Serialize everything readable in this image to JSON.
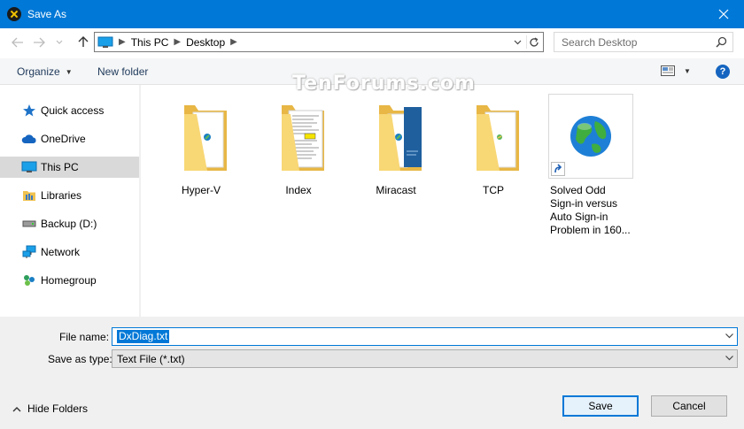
{
  "window": {
    "title": "Save As"
  },
  "address": {
    "crumbs": [
      "This PC",
      "Desktop"
    ]
  },
  "search": {
    "placeholder": "Search Desktop"
  },
  "toolbar": {
    "organize": "Organize",
    "new_folder": "New folder",
    "help": "?"
  },
  "nav": {
    "items": [
      {
        "label": "Quick access",
        "icon": "star-icon"
      },
      {
        "label": "OneDrive",
        "icon": "cloud-icon"
      },
      {
        "label": "This PC",
        "icon": "computer-icon",
        "selected": true
      },
      {
        "label": "Libraries",
        "icon": "library-folder-icon"
      },
      {
        "label": "Backup (D:)",
        "icon": "drive-icon"
      },
      {
        "label": "Network",
        "icon": "network-icon"
      },
      {
        "label": "Homegroup",
        "icon": "homegroup-icon"
      }
    ]
  },
  "watermark": "TenForums.com",
  "files": [
    {
      "name": "Hyper-V",
      "type": "folder"
    },
    {
      "name": "Index",
      "type": "folder"
    },
    {
      "name": "Miracast",
      "type": "folder"
    },
    {
      "name": "TCP",
      "type": "folder"
    },
    {
      "name": "Solved Odd Sign-in versus Auto Sign-in Problem in 160...",
      "lines": [
        "Solved Odd",
        "Sign-in versus",
        "Auto Sign-in",
        "Problem in 160..."
      ],
      "type": "shortcut"
    }
  ],
  "form": {
    "file_name_label": "File name:",
    "file_name_value": "DxDiag.txt",
    "save_type_label": "Save as type:",
    "save_type_value": "Text File (*.txt)"
  },
  "footer": {
    "hide_folders": "Hide Folders",
    "save": "Save",
    "cancel": "Cancel"
  },
  "colors": {
    "accent": "#0078d7",
    "folder": "#f8d775",
    "selection": "#d9d9d9"
  }
}
